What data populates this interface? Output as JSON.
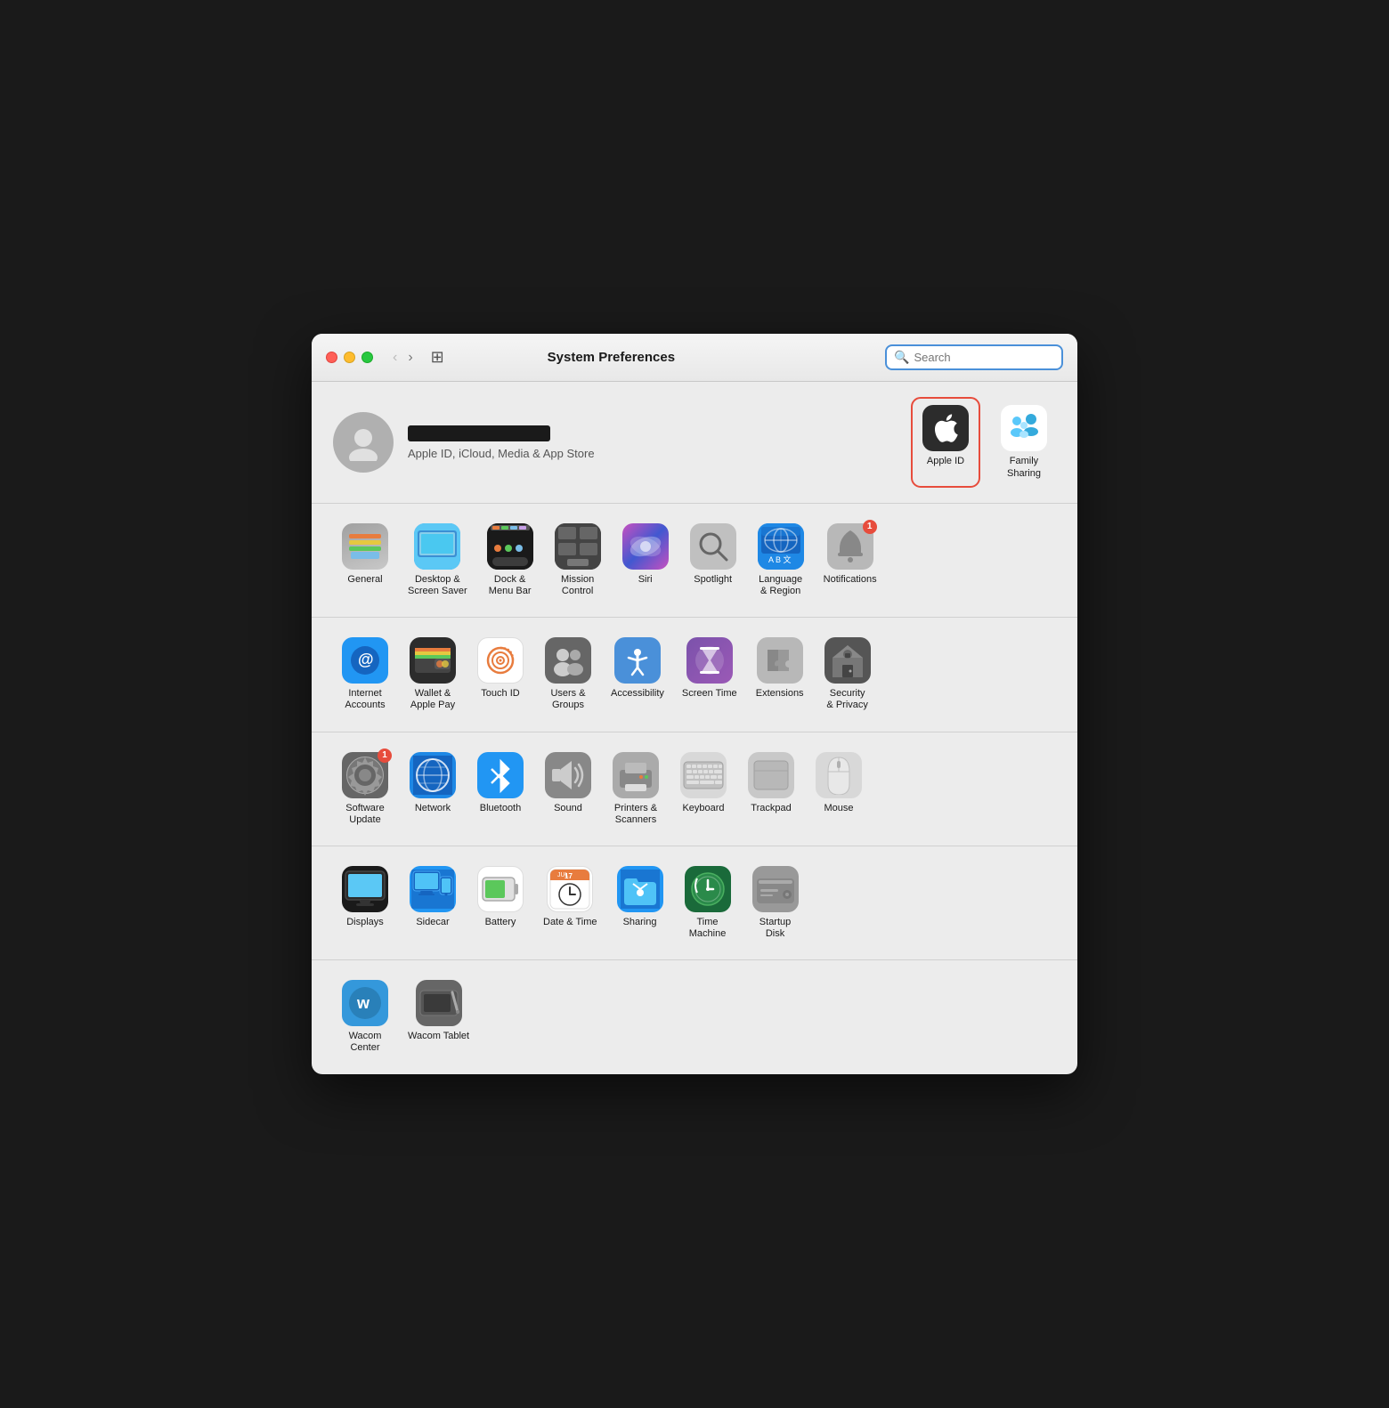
{
  "window": {
    "title": "System Preferences"
  },
  "titlebar": {
    "back_label": "‹",
    "forward_label": "›",
    "grid_label": "⊞",
    "title": "System Preferences",
    "search_placeholder": "Search"
  },
  "profile": {
    "subtitle": "Apple ID, iCloud, Media & App Store"
  },
  "profile_icons": [
    {
      "id": "apple-id",
      "label": "Apple ID",
      "selected": true,
      "badge": null
    },
    {
      "id": "family-sharing",
      "label": "Family\nSharing",
      "selected": false,
      "badge": null
    }
  ],
  "sections": [
    {
      "id": "row1",
      "items": [
        {
          "id": "general",
          "label": "General",
          "badge": null
        },
        {
          "id": "desktop-screen-saver",
          "label": "Desktop &\nScreen Saver",
          "badge": null
        },
        {
          "id": "dock-menu-bar",
          "label": "Dock &\nMenu Bar",
          "badge": null
        },
        {
          "id": "mission-control",
          "label": "Mission\nControl",
          "badge": null
        },
        {
          "id": "siri",
          "label": "Siri",
          "badge": null
        },
        {
          "id": "spotlight",
          "label": "Spotlight",
          "badge": null
        },
        {
          "id": "language-region",
          "label": "Language\n& Region",
          "badge": null
        },
        {
          "id": "notifications",
          "label": "Notifications",
          "badge": "1"
        }
      ]
    },
    {
      "id": "row2",
      "items": [
        {
          "id": "internet-accounts",
          "label": "Internet\nAccounts",
          "badge": null
        },
        {
          "id": "wallet-apple-pay",
          "label": "Wallet &\nApple Pay",
          "badge": null
        },
        {
          "id": "touch-id",
          "label": "Touch ID",
          "badge": null
        },
        {
          "id": "users-groups",
          "label": "Users &\nGroups",
          "badge": null
        },
        {
          "id": "accessibility",
          "label": "Accessibility",
          "badge": null
        },
        {
          "id": "screen-time",
          "label": "Screen Time",
          "badge": null
        },
        {
          "id": "extensions",
          "label": "Extensions",
          "badge": null
        },
        {
          "id": "security-privacy",
          "label": "Security\n& Privacy",
          "badge": null
        }
      ]
    },
    {
      "id": "row3",
      "items": [
        {
          "id": "software-update",
          "label": "Software\nUpdate",
          "badge": "1"
        },
        {
          "id": "network",
          "label": "Network",
          "badge": null
        },
        {
          "id": "bluetooth",
          "label": "Bluetooth",
          "badge": null
        },
        {
          "id": "sound",
          "label": "Sound",
          "badge": null
        },
        {
          "id": "printers-scanners",
          "label": "Printers &\nScanners",
          "badge": null
        },
        {
          "id": "keyboard",
          "label": "Keyboard",
          "badge": null
        },
        {
          "id": "trackpad",
          "label": "Trackpad",
          "badge": null
        },
        {
          "id": "mouse",
          "label": "Mouse",
          "badge": null
        }
      ]
    },
    {
      "id": "row4",
      "items": [
        {
          "id": "displays",
          "label": "Displays",
          "badge": null
        },
        {
          "id": "sidecar",
          "label": "Sidecar",
          "badge": null
        },
        {
          "id": "battery",
          "label": "Battery",
          "badge": null
        },
        {
          "id": "date-time",
          "label": "Date & Time",
          "badge": null
        },
        {
          "id": "sharing",
          "label": "Sharing",
          "badge": null
        },
        {
          "id": "time-machine",
          "label": "Time\nMachine",
          "badge": null
        },
        {
          "id": "startup-disk",
          "label": "Startup\nDisk",
          "badge": null
        }
      ]
    },
    {
      "id": "row5",
      "items": [
        {
          "id": "wacom-center",
          "label": "Wacom\nCenter",
          "badge": null
        },
        {
          "id": "wacom-tablet",
          "label": "Wacom Tablet",
          "badge": null
        }
      ]
    }
  ]
}
